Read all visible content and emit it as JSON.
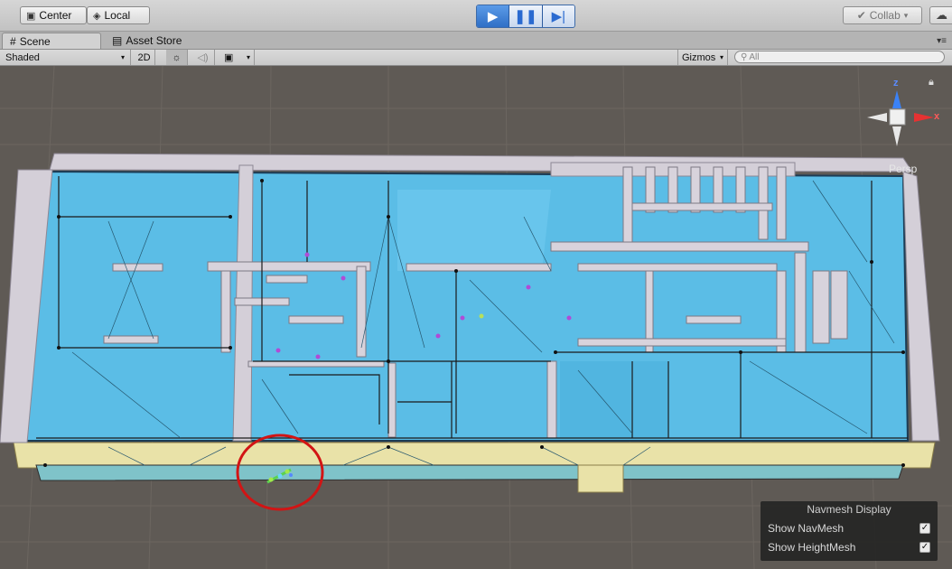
{
  "toolbar": {
    "pivot_label": "Center",
    "rotation_label": "Local",
    "play_icons": [
      "play-icon",
      "pause-icon",
      "step-icon"
    ],
    "collab_label": "Collab",
    "collab_check_icon": "check-icon"
  },
  "tabs": [
    {
      "label": "Scene",
      "icon": "grid-icon",
      "active": true
    },
    {
      "label": "Asset Store",
      "icon": "bag-icon",
      "active": false
    }
  ],
  "scene_toolbar": {
    "shading_mode": "Shaded",
    "mode_2d": "2D",
    "gizmos_label": "Gizmos",
    "search_placeholder": "All"
  },
  "gizmo": {
    "z_label": "z",
    "x_label": "x",
    "projection_label": "Persp"
  },
  "navmesh_display": {
    "title": "Navmesh Display",
    "options": [
      {
        "label": "Show NavMesh",
        "checked": true
      },
      {
        "label": "Show HeightMesh",
        "checked": true
      }
    ]
  },
  "colors": {
    "navmesh": "#5bbde6",
    "walls": "#d4cfd8",
    "highlight_circle": "#d21414",
    "play_active": "#3a7fd6"
  }
}
